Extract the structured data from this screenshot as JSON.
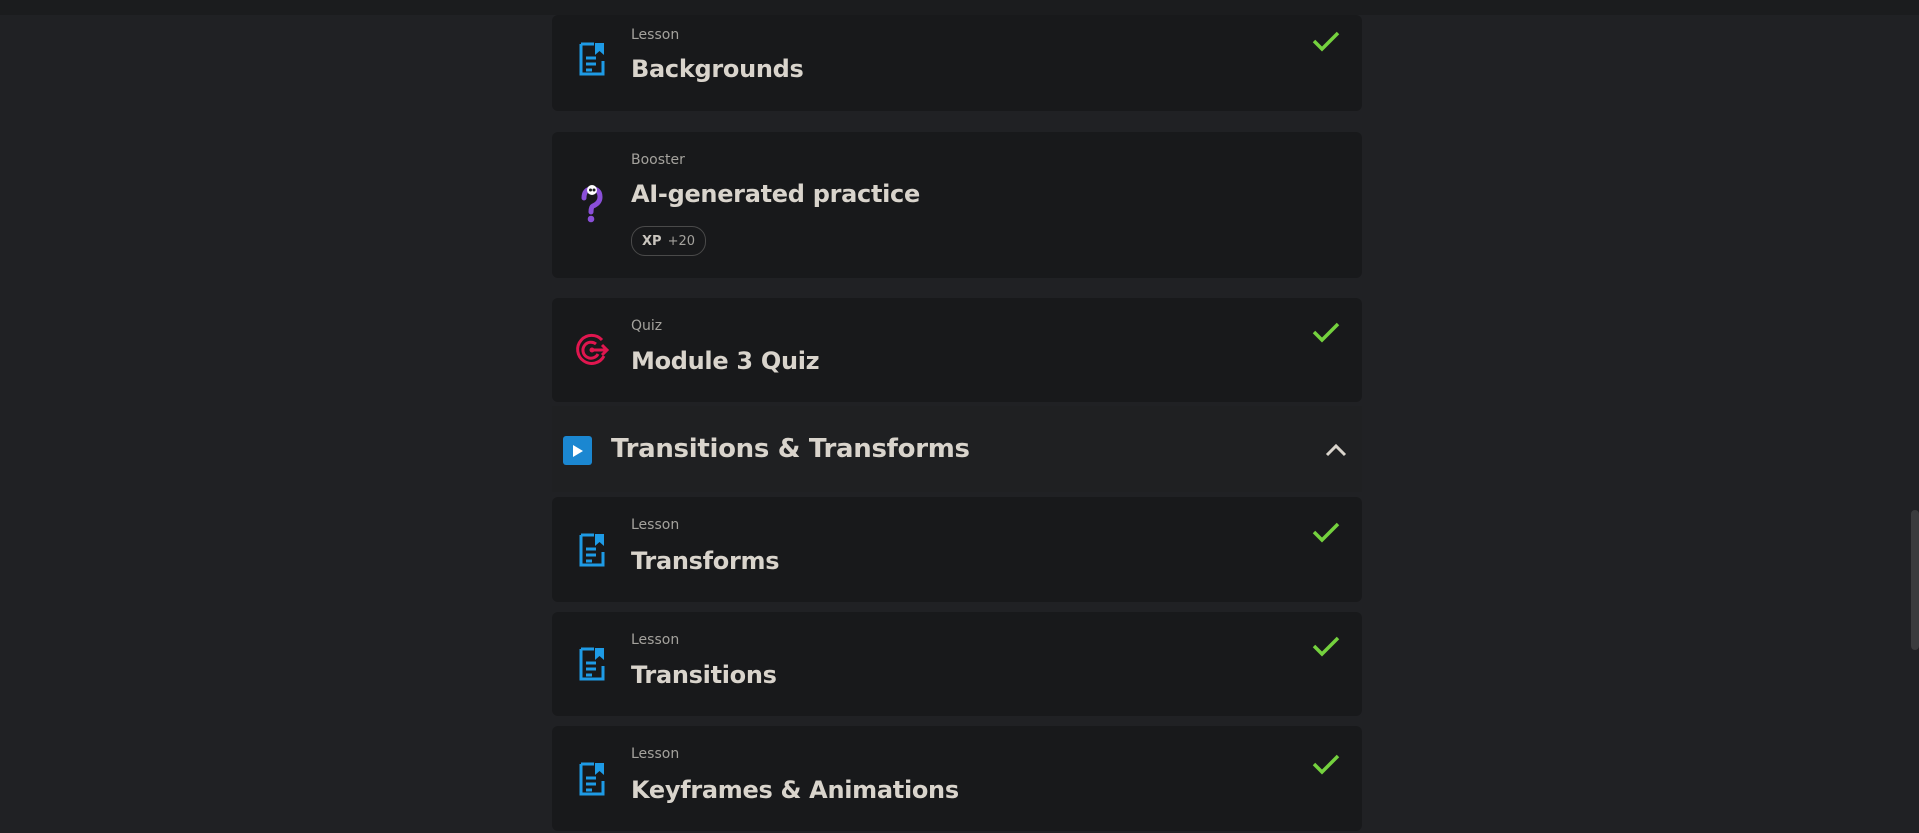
{
  "items_top": [
    {
      "kind": "Lesson",
      "title": "Backgrounds",
      "icon": "document-icon",
      "completed": true
    },
    {
      "kind": "Booster",
      "title": "AI-generated practice",
      "icon": "question-mark-icon",
      "completed": false,
      "xp": {
        "label": "XP",
        "value": "+20"
      }
    },
    {
      "kind": "Quiz",
      "title": "Module 3 Quiz",
      "icon": "target-icon",
      "completed": true
    }
  ],
  "section": {
    "title": "Transitions & Transforms",
    "icon": "play-icon",
    "state_icon": "chevron-up-icon"
  },
  "items_section": [
    {
      "kind": "Lesson",
      "title": "Transforms",
      "icon": "document-icon",
      "completed": true
    },
    {
      "kind": "Lesson",
      "title": "Transitions",
      "icon": "document-icon",
      "completed": true
    },
    {
      "kind": "Lesson",
      "title": "Keyframes & Animations",
      "icon": "document-icon",
      "completed": true
    }
  ],
  "colors": {
    "background": "#202124",
    "card": "#18191b",
    "check": "#74d13e",
    "lesson_icon": "#1e9be6",
    "quiz_icon": "#e0164f",
    "booster_icon": "#8a4fd8",
    "section_icon": "#1b87d1"
  }
}
